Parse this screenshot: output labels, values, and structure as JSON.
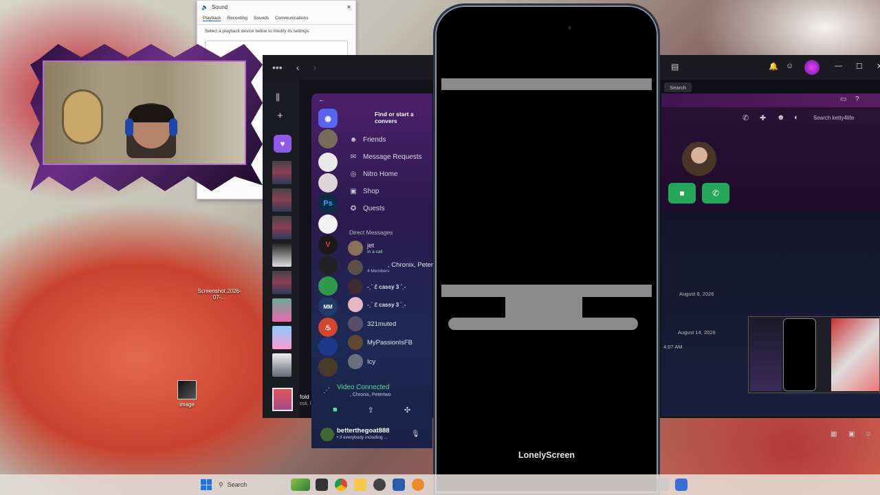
{
  "desktop": {
    "icons": [
      {
        "label": "Screenshot 2026-07-...",
        "id": "screenshot"
      },
      {
        "label": "image",
        "id": "image"
      }
    ]
  },
  "sound_window": {
    "title": "Sound",
    "tabs": [
      "Playback",
      "Recording",
      "Sounds",
      "Communications"
    ],
    "hint": "Select a playback device below to modify its settings:"
  },
  "discord": {
    "find_placeholder": "Find or start a convers",
    "nav": [
      {
        "label": "Friends",
        "icon": "friends-icon",
        "glyph": "☻"
      },
      {
        "label": "Message Requests",
        "icon": "mail-icon",
        "glyph": "✉"
      },
      {
        "label": "Nitro Home",
        "icon": "nitro-icon",
        "glyph": "◎"
      },
      {
        "label": "Shop",
        "icon": "shop-icon",
        "glyph": "▣"
      },
      {
        "label": "Quests",
        "icon": "quests-icon",
        "glyph": "✪"
      }
    ],
    "dm_header": "Direct Messages",
    "dms": [
      {
        "name": "jet",
        "sub": "In a call"
      },
      {
        "name": ", Chronix, Peter",
        "sub": "4 Members"
      },
      {
        "name": "-ˏˋ ℰ cassy 3 ˊˎ-",
        "sub": ""
      },
      {
        "name": "-ˏˋ ℰ cassy 3 ˊˎ-",
        "sub": ""
      },
      {
        "name": "321muted",
        "sub": ""
      },
      {
        "name": "MyPassionIsFB",
        "sub": ""
      },
      {
        "name": "Icy",
        "sub": ""
      }
    ],
    "guild_ps": "Ps",
    "voice": {
      "status": "Video Connected",
      "channel": ", Chronix, Petertwo"
    },
    "user": {
      "name": "betterthegoat888",
      "status": "• if everybody including ..."
    },
    "folder": {
      "name": "fold",
      "sub": "osk, l"
    },
    "right": {
      "search_top": "Search",
      "search_label": "Search ketty4life",
      "dates": [
        "August 8, 2026",
        "August 14, 2026"
      ],
      "time": "4:07 AM"
    }
  },
  "phone": {
    "label": "LonelyScreen"
  },
  "taskbar": {
    "search": "Search"
  },
  "colors": {
    "discord_green": "#23a55a",
    "discord_blurple": "#5865f2",
    "windows_blue": "#1a73e8"
  }
}
